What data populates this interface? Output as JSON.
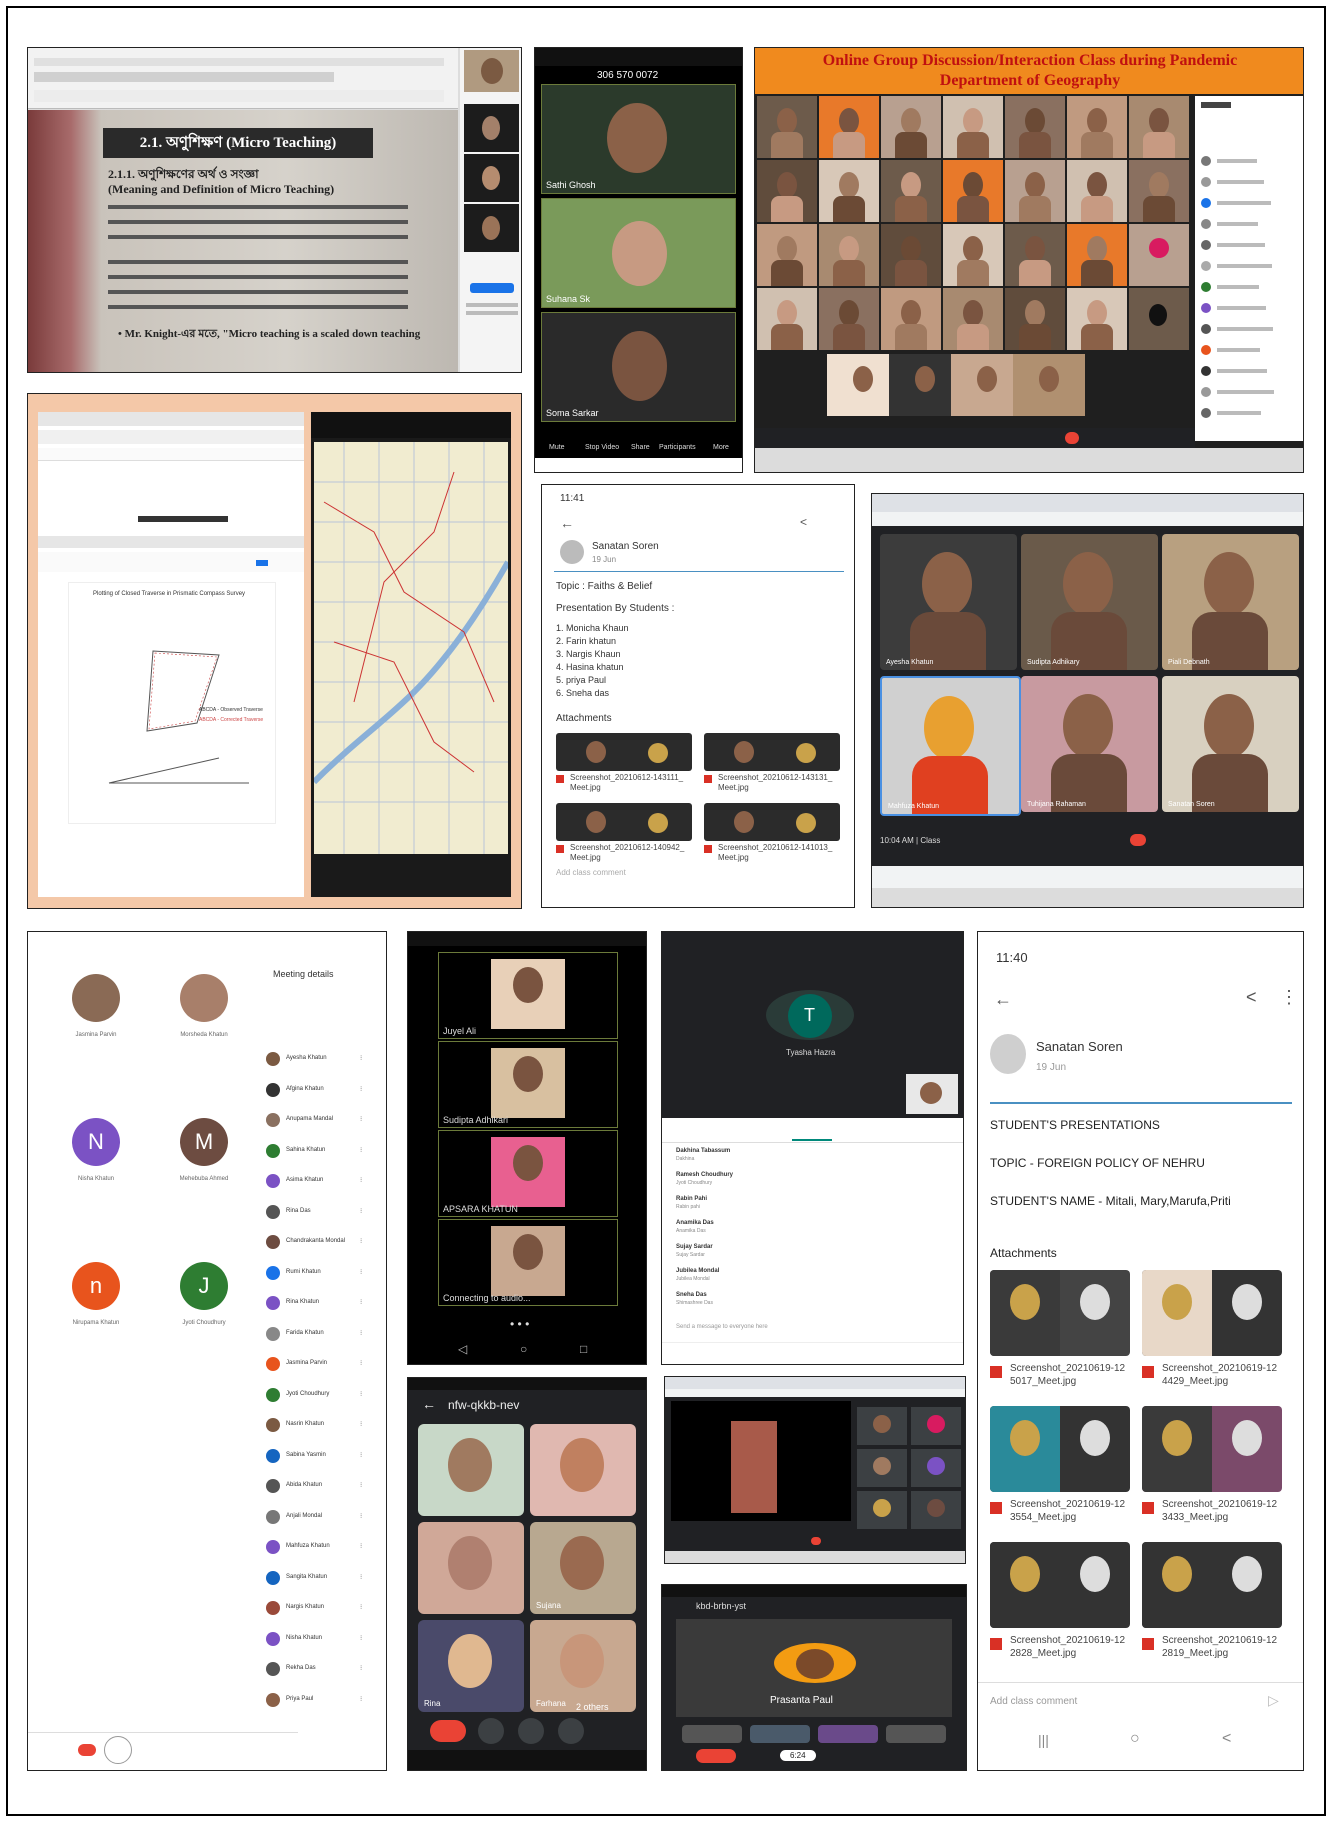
{
  "banner": {
    "line1": "Online Group Discussion/Interaction Class during Pandemic",
    "line2": "Department of Geography"
  },
  "book": {
    "heading": "2.1. অণুশিক্ষণ (Micro Teaching)",
    "sub1": "2.1.1. অণুশিক্ষণের অর্থ ও সংজ্ঞা",
    "sub2": "(Meaning and Definition of Micro Teaching)",
    "quote": "• Mr. Knight-এর মতে, \"Micro teaching is a scaled down teaching"
  },
  "phone1": {
    "number": "306 570 0072",
    "tiles": [
      "Sathi Ghosh",
      "Suhana Sk",
      "Soma Sarkar"
    ],
    "controls": [
      "Mute",
      "Stop Video",
      "Share",
      "Participants",
      "More"
    ]
  },
  "post1": {
    "status_time": "11:41",
    "author": "Sanatan Soren",
    "date": "19 Jun",
    "topic": "Topic : Faiths & Belief",
    "presentation_by": "Presentation By Students :",
    "students": [
      "1. Monicha Khaun",
      "2. Farin khatun",
      "3. Nargis Khaun",
      "4. Hasina khatun",
      "5. priya Paul",
      "6. Sneha das"
    ],
    "attachments_label": "Attachments",
    "files": [
      "Screenshot_20210612-143111_Meet.jpg",
      "Screenshot_20210612-143131_Meet.jpg",
      "Screenshot_20210612-140942_Meet.jpg",
      "Screenshot_20210612-141013_Meet.jpg"
    ],
    "comment": "Add class comment"
  },
  "map_panel": {
    "plot_title": "Plotting of Closed Traverse in Prismatic Compass Survey",
    "legend": [
      "ABCDA - Observed Traverse",
      "ABCDA - Corrected Traverse"
    ]
  },
  "meet2": {
    "names": [
      "Ayesha Khatun",
      "Sudipta Adhikary",
      "Piali Debnath",
      "Mahfuza Khatun",
      "Tuhijana Rahaman",
      "Sanatan Soren"
    ],
    "time": "10:04 AM",
    "meeting": "Class"
  },
  "meet_list": {
    "title": "Meeting details",
    "avatars": [
      {
        "letter": "",
        "name": "Jasmina Parvin",
        "color": "#8a6a55"
      },
      {
        "letter": "",
        "name": "Morsheda Khatun",
        "color": "#a87f6a"
      },
      {
        "letter": "N",
        "name": "Nisha Khatun",
        "color": "#7b52c4"
      },
      {
        "letter": "M",
        "name": "Mehebuba Ahmed",
        "color": "#6d4c41"
      },
      {
        "letter": "n",
        "name": "Nirupama Khatun",
        "color": "#e8541d"
      },
      {
        "letter": "J",
        "name": "Jyoti Choudhury",
        "color": "#2e7d32"
      }
    ],
    "people": [
      "Ayesha Khatun",
      "Afgina Khatun",
      "Anupama Mandal",
      "Sahina Khatun",
      "Asima Khatun",
      "Rina Das",
      "Chandrakanta Mondal",
      "Rumi Khatun",
      "Rina Khatun",
      "Farida Khatun",
      "Jasmina Parvin",
      "Jyoti Choudhury",
      "Nasrin Khatun",
      "Sabina Yasmin",
      "Abida Khatun",
      "Anjali Mondal",
      "Mahfuza Khatun",
      "Sangita Khatun",
      "Nargis Khatun",
      "Nisha Khatun",
      "Rekha Das",
      "Priya Paul"
    ]
  },
  "phone2": {
    "tiles": [
      "Juyel Ali",
      "Sudipta Adhikari",
      "APSARA KHATUN",
      "Connecting to audio..."
    ]
  },
  "phone3": {
    "initial": "T",
    "name": "Tyasha Hazra",
    "list": [
      {
        "n": "Dakhina Tabassum",
        "s": "Dakhina"
      },
      {
        "n": "Ramesh Choudhury",
        "s": "Jyoti Choudhury"
      },
      {
        "n": "Rabin Pahi",
        "s": "Rabin pahi"
      },
      {
        "n": "Anamika Das",
        "s": "Anamika Das"
      },
      {
        "n": "Sujay Sardar",
        "s": "Sujay Sardar"
      },
      {
        "n": "Jubilea Mondal",
        "s": "Jubilea Mondal"
      },
      {
        "n": "Sneha Das",
        "s": "Shimashree Das"
      }
    ],
    "send": "Send a message to everyone here"
  },
  "post2": {
    "status_time": "11:40",
    "author": "Sanatan Soren",
    "date": "19 Jun",
    "heading": "STUDENT'S PRESENTATIONS",
    "topic": "TOPIC - FOREIGN POLICY OF NEHRU",
    "names": "STUDENT'S NAME - Mitali, Mary,Marufa,Priti",
    "attachments_label": "Attachments",
    "files": [
      "Screenshot_20210619-125017_Meet.jpg",
      "Screenshot_20210619-124429_Meet.jpg",
      "Screenshot_20210619-123554_Meet.jpg",
      "Screenshot_20210619-123433_Meet.jpg",
      "Screenshot_20210619-122828_Meet.jpg",
      "Screenshot_20210619-122819_Meet.jpg"
    ],
    "comment": "Add class comment"
  },
  "phone4": {
    "code": "nfw-qkkb-nev",
    "names": [
      "",
      "",
      "",
      "Sujana",
      "Rina",
      "Farhana"
    ],
    "others": "2 others"
  },
  "phone5": {
    "code": "kbd-brbn-yst",
    "name": "Prasanta Paul",
    "pill": "6:24"
  }
}
